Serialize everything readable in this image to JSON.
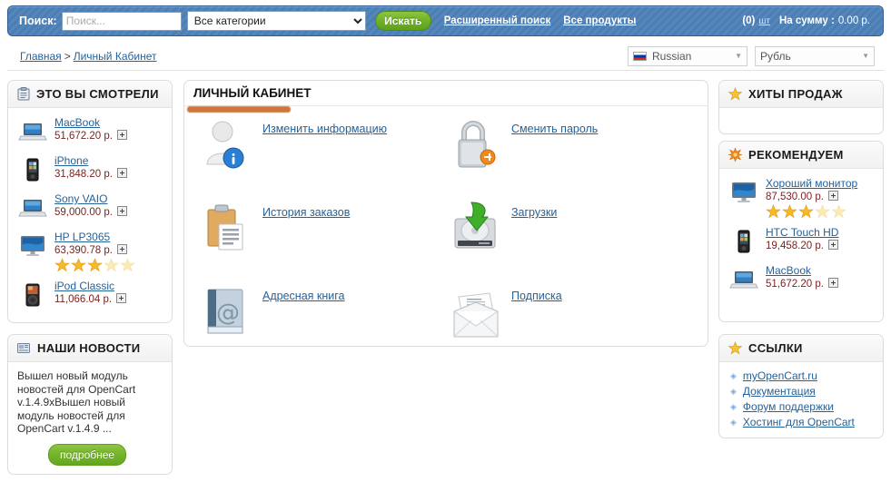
{
  "topbar": {
    "search_label": "Поиск:",
    "search_placeholder": "Поиск...",
    "search_value": "",
    "category_selected": "Все категории",
    "category_options": [
      "Все категории"
    ],
    "search_button": "Искать",
    "advanced_search": "Расширенный поиск",
    "all_products": "Все продукты",
    "cart_count": "(0)",
    "cart_unit": "шт",
    "cart_total_label": "На сумму :",
    "cart_total_value": "0.00 р."
  },
  "breadcrumb": {
    "home": "Главная",
    "separator": ">",
    "current": "Личный Кабинет"
  },
  "selectors": {
    "language": "Russian",
    "currency": "Рубль"
  },
  "left_sidebar": {
    "viewed": {
      "title": "ЭТО ВЫ СМОТРЕЛИ",
      "icon": "clipboard-icon",
      "items": [
        {
          "name": "MacBook",
          "price": "51,672.20 р.",
          "thumb": "laptop-icon",
          "rating": null
        },
        {
          "name": "iPhone",
          "price": "31,848.20 р.",
          "thumb": "phone-icon",
          "rating": null
        },
        {
          "name": "Sony VAIO",
          "price": "59,000.00 р.",
          "thumb": "laptop-icon",
          "rating": null
        },
        {
          "name": "HP LP3065",
          "price": "63,390.78 р.",
          "thumb": "monitor-icon",
          "rating": 3
        },
        {
          "name": "iPod Classic",
          "price": "11,066.04 р.",
          "thumb": "ipod-icon",
          "rating": null
        }
      ]
    },
    "news": {
      "title": "НАШИ НОВОСТИ",
      "icon": "news-icon",
      "text": "Вышел новый модуль новостей для OpenCart v.1.4.9хВышел новый модуль новостей для OpenCart v.1.4.9 ...",
      "more_button": "подробнее"
    }
  },
  "main": {
    "title": "ЛИЧНЫЙ КАБИНЕТ",
    "items": [
      {
        "label": "Изменить информацию",
        "icon": "user-info-icon"
      },
      {
        "label": "Сменить пароль",
        "icon": "padlock-icon"
      },
      {
        "label": "История заказов",
        "icon": "clipboard-orders-icon"
      },
      {
        "label": "Загрузки",
        "icon": "harddrive-download-icon"
      },
      {
        "label": "Адресная книга",
        "icon": "address-book-icon"
      },
      {
        "label": "Подписка",
        "icon": "envelope-icon"
      }
    ]
  },
  "right_sidebar": {
    "bestsellers": {
      "title": "ХИТЫ ПРОДАЖ",
      "icon": "star-icon",
      "items": []
    },
    "featured": {
      "title": "РЕКОМЕНДУЕМ",
      "icon": "starburst-icon",
      "items": [
        {
          "name": "Хороший монитор",
          "price": "87,530.00 р.",
          "thumb": "monitor-icon",
          "rating": 3
        },
        {
          "name": "HTC Touch HD",
          "price": "19,458.20 р.",
          "thumb": "phone-icon",
          "rating": null
        },
        {
          "name": "MacBook",
          "price": "51,672.20 р.",
          "thumb": "laptop-icon",
          "rating": null
        }
      ]
    },
    "links": {
      "title": "ССЫЛКИ",
      "icon": "star-icon",
      "items": [
        "myOpenCart.ru",
        "Документация",
        "Форум поддержки",
        "Хостинг для OpenCart"
      ]
    }
  },
  "colors": {
    "header_blue": "#4a7eb5",
    "link_blue": "#24629a",
    "price_red": "#7a2222",
    "button_green": "#72b32a",
    "annotation_orange": "#cc6b2a",
    "star_gold": "#f5b92b"
  }
}
